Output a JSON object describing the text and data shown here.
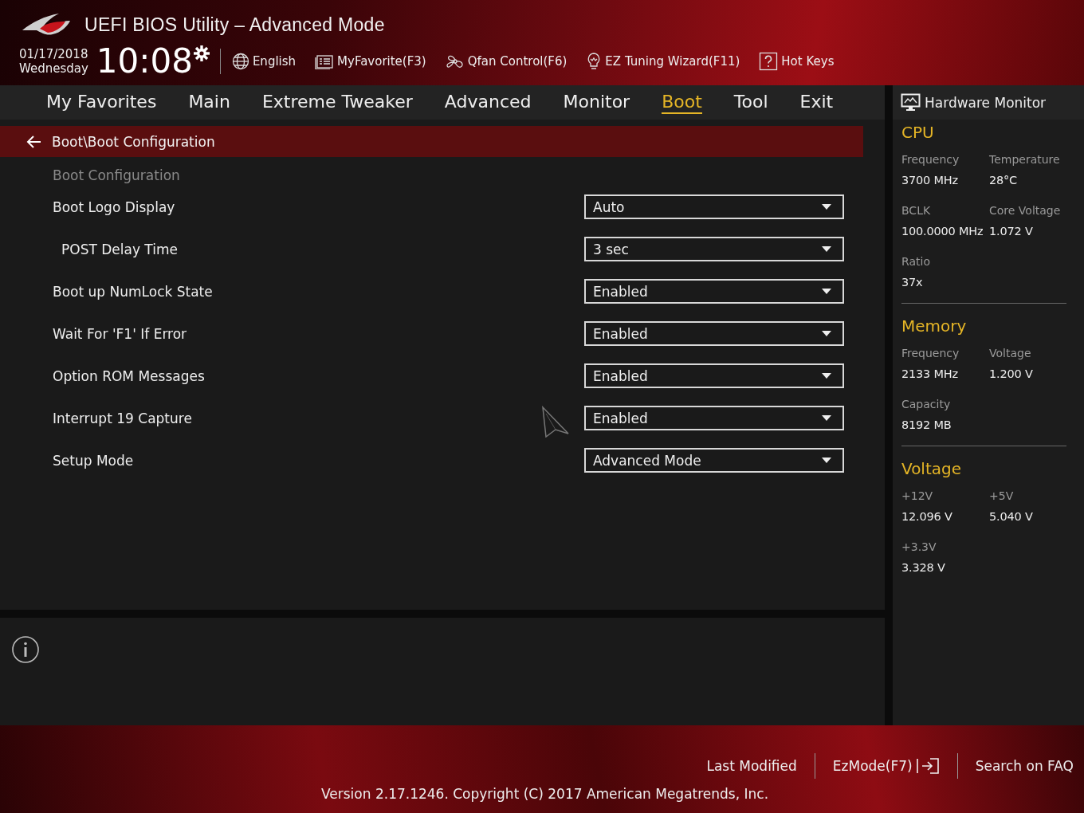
{
  "window": {
    "title": "UEFI BIOS Utility – Advanced Mode"
  },
  "clock": {
    "date": "01/17/2018",
    "weekday": "Wednesday",
    "time": "10:08"
  },
  "toolbar": [
    {
      "kind": "language",
      "label": "English"
    },
    {
      "kind": "favorite",
      "label": "MyFavorite(F3)"
    },
    {
      "kind": "fan",
      "label": "Qfan Control(F6)"
    },
    {
      "kind": "wizard",
      "label": "EZ Tuning Wizard(F11)"
    },
    {
      "kind": "help",
      "label": "Hot Keys"
    }
  ],
  "tabs": [
    {
      "label": "My Favorites",
      "selected": false
    },
    {
      "label": "Main",
      "selected": false
    },
    {
      "label": "Extreme Tweaker",
      "selected": false
    },
    {
      "label": "Advanced",
      "selected": false
    },
    {
      "label": "Monitor",
      "selected": false
    },
    {
      "label": "Boot",
      "selected": true
    },
    {
      "label": "Tool",
      "selected": false
    },
    {
      "label": "Exit",
      "selected": false
    }
  ],
  "breadcrumb": "Boot\\Boot Configuration",
  "section_title": "Boot Configuration",
  "settings": [
    {
      "label": "Boot Logo Display",
      "value": "Auto",
      "children": [
        {
          "label": "POST Delay Time",
          "value": "3 sec"
        }
      ]
    },
    {
      "label": "Boot up NumLock State",
      "value": "Enabled"
    },
    {
      "label": "Wait For 'F1' If Error",
      "value": "Enabled"
    },
    {
      "label": "Option ROM Messages",
      "value": "Enabled"
    },
    {
      "label": "Interrupt 19 Capture",
      "value": "Enabled"
    },
    {
      "label": "Setup Mode",
      "value": "Advanced Mode"
    }
  ],
  "hardware_monitor": {
    "title": "Hardware Monitor",
    "sections": [
      {
        "title": "CPU",
        "items": [
          {
            "label": "Frequency",
            "value": "3700 MHz"
          },
          {
            "label": "Temperature",
            "value": "28°C"
          },
          {
            "label": "BCLK",
            "value": "100.0000 MHz"
          },
          {
            "label": "Core Voltage",
            "value": "1.072 V"
          },
          {
            "label": "Ratio",
            "value": "37x"
          }
        ]
      },
      {
        "title": "Memory",
        "items": [
          {
            "label": "Frequency",
            "value": "2133 MHz"
          },
          {
            "label": "Voltage",
            "value": "1.200 V"
          },
          {
            "label": "Capacity",
            "value": "8192 MB"
          }
        ]
      },
      {
        "title": "Voltage",
        "items": [
          {
            "label": "+12V",
            "value": "12.096 V"
          },
          {
            "label": "+5V",
            "value": "5.040 V"
          },
          {
            "label": "+3.3V",
            "value": "3.328 V"
          }
        ]
      }
    ]
  },
  "footer": {
    "links": [
      {
        "kind": "text",
        "label": "Last Modified"
      },
      {
        "kind": "exit",
        "label": "EzMode(F7)"
      },
      {
        "kind": "text",
        "label": "Search on FAQ"
      }
    ],
    "version": "Version 2.17.1246. Copyright (C) 2017 American Megatrends, Inc."
  }
}
